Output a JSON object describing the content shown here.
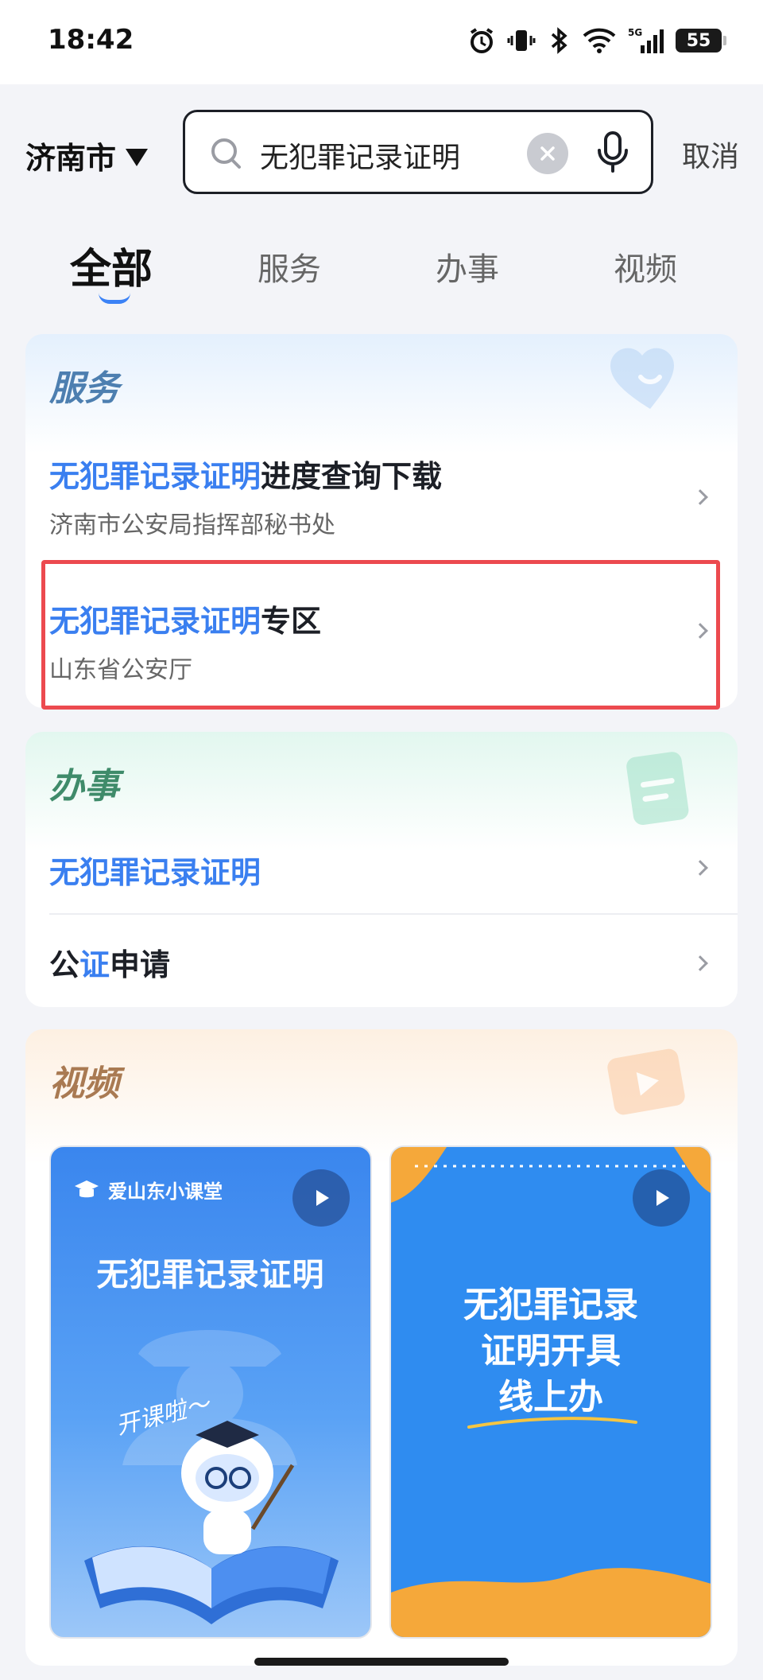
{
  "status_bar": {
    "time": "18:42",
    "network": "5G",
    "battery": "55"
  },
  "search": {
    "city": "济南市",
    "query": "无犯罪记录证明",
    "cancel_label": "取消"
  },
  "tabs": [
    {
      "label": "全部",
      "active": true
    },
    {
      "label": "服务",
      "active": false
    },
    {
      "label": "办事",
      "active": false
    },
    {
      "label": "视频",
      "active": false
    }
  ],
  "service_section": {
    "title": "服务",
    "items": [
      {
        "highlight": "无犯罪记录证明",
        "rest": "进度查询下载",
        "subtitle": "济南市公安局指挥部秘书处"
      },
      {
        "highlight": "无犯罪记录证明",
        "rest": "专区",
        "subtitle": "山东省公安厅"
      }
    ]
  },
  "affairs_section": {
    "title": "办事",
    "items": [
      {
        "pre": "",
        "highlight": "无犯罪记录证明",
        "rest": ""
      },
      {
        "pre": "公",
        "highlight": "证",
        "rest": "申请"
      }
    ]
  },
  "video_section": {
    "title": "视频",
    "videos": [
      {
        "brand": "爱山东小课堂",
        "title": "无犯罪记录证明",
        "tagline": "开课啦～"
      },
      {
        "title_line1": "无犯罪记录",
        "title_line2": "证明开具",
        "title_line3": "线上办"
      }
    ]
  },
  "colors": {
    "accent": "#3a7ff0",
    "highlight_border": "#ec4a4f"
  }
}
